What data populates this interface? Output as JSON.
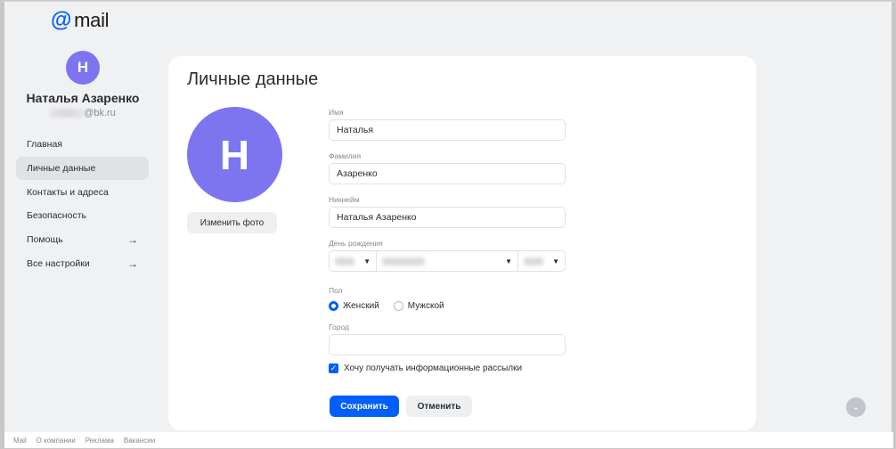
{
  "logo": {
    "symbol": "@",
    "text": "mail"
  },
  "user": {
    "initial": "Н",
    "name": "Наталья Азаренко",
    "email_domain": "@bk.ru"
  },
  "sidebar": {
    "items": [
      {
        "label": "Главная",
        "arrow": "",
        "active": false
      },
      {
        "label": "Личные данные",
        "arrow": "",
        "active": true
      },
      {
        "label": "Контакты и адреса",
        "arrow": "",
        "active": false
      },
      {
        "label": "Безопасность",
        "arrow": "",
        "active": false
      },
      {
        "label": "Помощь",
        "arrow": "→",
        "active": false
      },
      {
        "label": "Все настройки",
        "arrow": "→",
        "active": false
      }
    ]
  },
  "page": {
    "title": "Личные данные",
    "change_photo": "Изменить фото"
  },
  "form": {
    "first_name": {
      "label": "Имя",
      "value": "Наталья"
    },
    "last_name": {
      "label": "Фамилия",
      "value": "Азаренко"
    },
    "nickname": {
      "label": "Никнейм",
      "value": "Наталья Азаренко"
    },
    "birthday": {
      "label": "День рождения"
    },
    "gender": {
      "label": "Пол",
      "female": "Женский",
      "male": "Мужской",
      "selected": "female"
    },
    "city": {
      "label": "Город",
      "value": ""
    },
    "newsletter": {
      "label": "Хочу получать информационные рассылки",
      "checked": true
    }
  },
  "actions": {
    "save": "Сохранить",
    "cancel": "Отменить"
  },
  "footer": {
    "links": [
      "Mail",
      "О компании",
      "Реклама",
      "Вакансии"
    ]
  },
  "colors": {
    "accent": "#005ff9",
    "avatar": "#7d74f0",
    "background": "#f0f1f3"
  }
}
